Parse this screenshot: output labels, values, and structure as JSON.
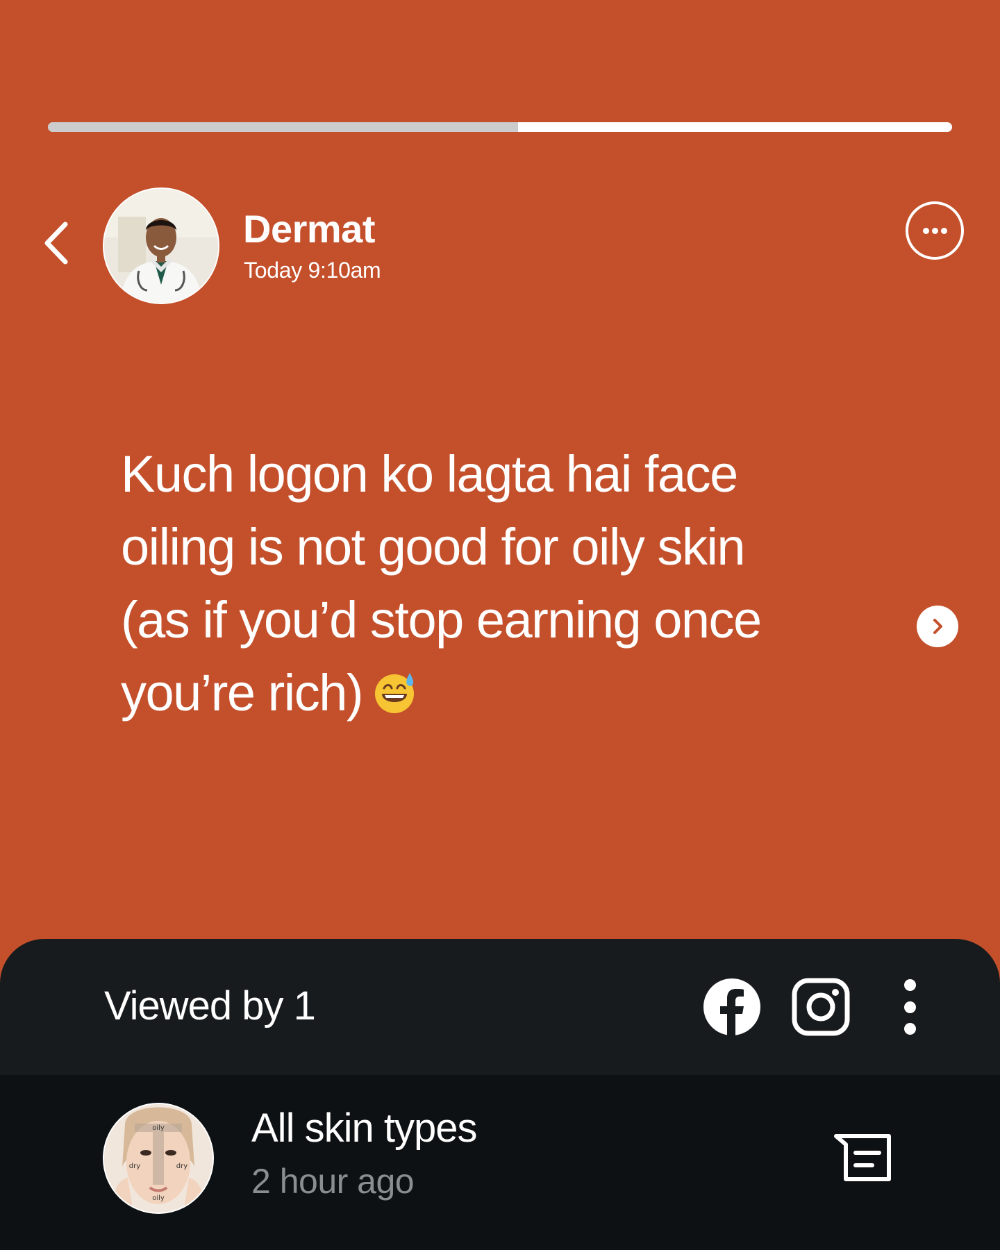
{
  "story": {
    "progress": 0.52,
    "author_name": "Dermat",
    "author_time": "Today 9:10am",
    "text": "Kuch logon ko lagta hai face oiling is not good for oily skin (as if you’d stop earning once you’re rich)",
    "emoji_icon": "grinning-face-with-sweat-icon",
    "background_color": "#c4502b"
  },
  "sheet": {
    "viewed_by": "Viewed by 1",
    "share_icons": [
      "facebook-icon",
      "instagram-icon",
      "more-vertical-icon"
    ],
    "viewer": {
      "title": "All skin types",
      "time": "2 hour ago",
      "avatar_labels": {
        "top": "oily",
        "left": "dry",
        "right": "dry",
        "bottom": "oily"
      }
    }
  }
}
